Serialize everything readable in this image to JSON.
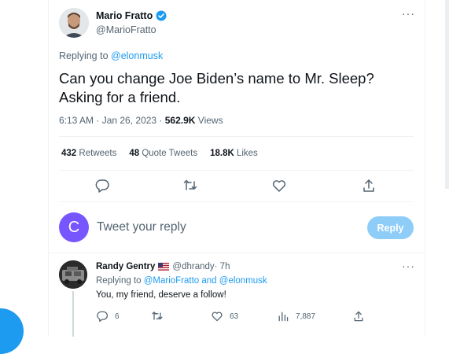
{
  "tweet": {
    "author_name": "Mario Fratto",
    "author_handle": "@MarioFratto",
    "replying_prefix": "Replying to ",
    "replying_to": "@elonmusk",
    "text": "Can you change Joe Biden’s name to Mr. Sleep? Asking for a friend.",
    "time": "6:13 AM · Jan 26, 2023 · ",
    "views_count": "562.9K",
    "views_label": " Views",
    "more": "···"
  },
  "stats": {
    "retweets_count": "432",
    "retweets_label": " Retweets",
    "quotes_count": "48",
    "quotes_label": " Quote Tweets",
    "likes_count": "18.8K",
    "likes_label": " Likes"
  },
  "composer": {
    "avatar_letter": "C",
    "placeholder": "Tweet your reply",
    "button": "Reply"
  },
  "reply": {
    "author_name": "Randy Gentry",
    "author_handle": "@dhrandy",
    "time": " · 7h",
    "replying_prefix": "Replying to ",
    "replying_to": "@MarioFratto and @elonmusk",
    "text": "You, my friend, deserve a follow!",
    "replies": "6",
    "likes": "63",
    "views": "7,887",
    "more": "···"
  },
  "colors": {
    "accent": "#1d9bf0",
    "reply_disabled": "#8ecdf7",
    "avatar_c": "#7856ff",
    "muted": "#536471"
  },
  "icons": [
    "verified-badge-icon",
    "reply-icon",
    "retweet-icon",
    "like-icon",
    "share-icon",
    "views-icon",
    "us-flag-icon"
  ]
}
